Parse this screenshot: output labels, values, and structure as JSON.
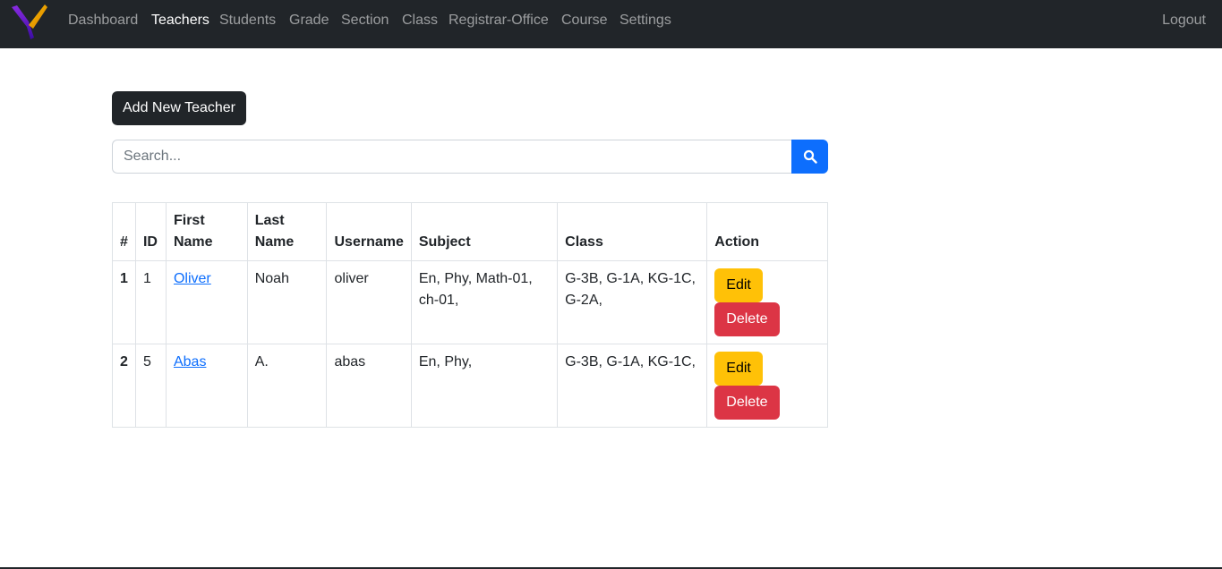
{
  "navbar": {
    "brand": "logo",
    "links": [
      "Dashboard",
      "Teachers",
      "Students",
      "Grade",
      "Section",
      "Class",
      "Registrar-Office",
      "Course",
      "Settings"
    ],
    "active": "Teachers",
    "logout": "Logout"
  },
  "actions": {
    "add_teacher": "Add New Teacher"
  },
  "search": {
    "placeholder": "Search...",
    "value": "",
    "icon": "search-icon"
  },
  "table": {
    "headers": {
      "index": "#",
      "id": "ID",
      "first_name": "First Name",
      "last_name": "Last Name",
      "username": "Username",
      "subject": "Subject",
      "class": "Class",
      "action": "Action"
    },
    "rows": [
      {
        "index": "1",
        "id": "1",
        "first_name": "Oliver",
        "last_name": "Noah",
        "username": "oliver",
        "subject": "En, Phy, Math-01, ch-01,",
        "class": "G-3B, G-1A, KG-1C, G-2A,",
        "edit": "Edit",
        "delete": "Delete"
      },
      {
        "index": "2",
        "id": "5",
        "first_name": "Abas",
        "last_name": "A.",
        "username": "abas",
        "subject": "En, Phy,",
        "class": "G-3B, G-1A, KG-1C,",
        "edit": "Edit",
        "delete": "Delete"
      }
    ]
  },
  "colors": {
    "navbar_bg": "#212529",
    "primary": "#0d6efd",
    "warning": "#ffc107",
    "danger": "#dc3545",
    "dark_button": "#212529"
  }
}
